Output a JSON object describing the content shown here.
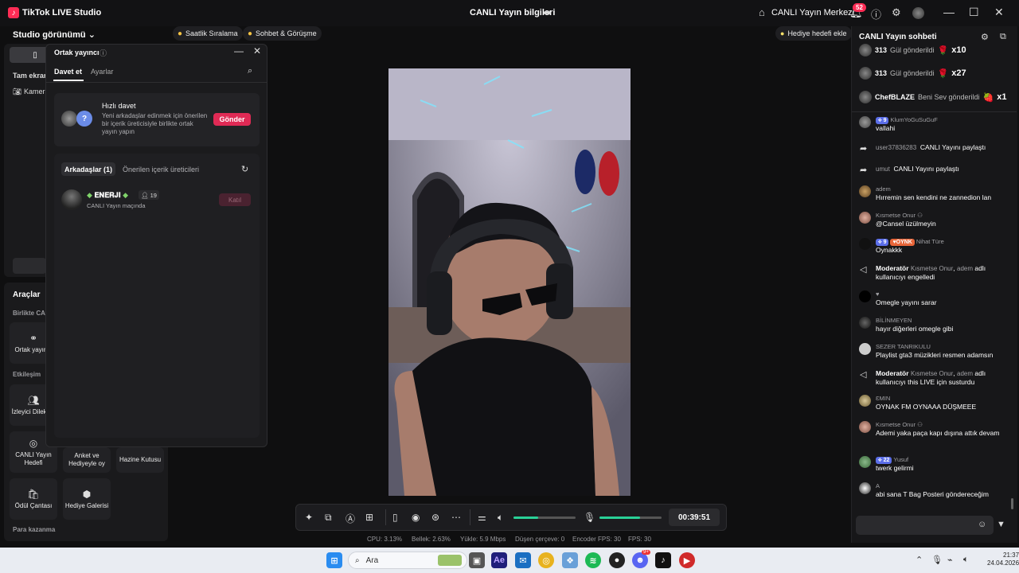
{
  "titlebar": {
    "app_name": "TikTok LIVE Studio",
    "center_title": "CANLI Yayın bilgileri",
    "live_center": "CANLI Yayın Merkezi",
    "notif_count": "52"
  },
  "left": {
    "studio_view": "Studio görünümü",
    "full_screen": "Tam ekran",
    "camera": "Kamera",
    "tools_title": "Araçlar",
    "section_together": "Birlikte CANLI",
    "cohost_tool": "Ortak yayıncı",
    "section_interaction": "Etkileşim",
    "viewer_requests": "İzleyici Dilekleri",
    "live_goal": "CANLI Yayın Hedefi",
    "poll_gift": "Anket ve Hediyeyle oy",
    "treasure": "Hazine Kutusu",
    "reward_bag": "Ödül Çantası",
    "gift_gallery": "Hediye Galerisi",
    "section_earn": "Para kazanma"
  },
  "chips": {
    "hourly_ranking": "Saatlik Sıralama",
    "chat_meet": "Sohbet & Görüşme",
    "add_gift_goal": "Hediye hedefi ekle"
  },
  "cohost_popup": {
    "title": "Ortak yayıncı",
    "tab_invite": "Davet et",
    "tab_settings": "Ayarlar",
    "quick_title": "Hızlı davet",
    "quick_desc": "Yeni arkadaşlar edinmek için önerilen bir içerik üreticisiyle birlikte ortak yayın yapın",
    "send_label": "Gönder",
    "tab_friends": "Arkadaşlar (1)",
    "tab_suggested": "Önerilen içerik üreticileri",
    "friend_name": "𝐄𝐍𝐄𝐑𝐉𝐈",
    "friend_count": "19",
    "friend_status": "CANLI Yayın maçında",
    "join_label": "Katıl"
  },
  "controls": {
    "timer": "00:39:51",
    "volume_level": 0.4,
    "mic_level": 0.65
  },
  "stats": {
    "cpu": "CPU: 3.13%",
    "memory": "Bellek: 2.63%",
    "upload": "Yükle: 5.9 Mbps",
    "dropped": "Düşen çerçeve: 0",
    "encoder_fps": "Encoder FPS: 30",
    "fps": "FPS: 30"
  },
  "chat": {
    "title": "CANLI Yayın sohbeti",
    "gifts": [
      {
        "user": "313",
        "action": "Gül gönderildi",
        "gift": "🌹",
        "mult": "x10"
      },
      {
        "user": "313",
        "action": "Gül gönderildi",
        "gift": "🌹",
        "mult": "x27"
      },
      {
        "user": "ChefBLAZE",
        "action": "Beni Sev gönderildi",
        "gift": "🍓",
        "mult": "x1"
      }
    ],
    "partial_user": "KlumYoGuSuGuF",
    "partial_badge": "9",
    "m1_text": "vallahi",
    "m2_user": "user37836283",
    "m2_text": "CANLI Yayını paylaştı",
    "m3_user": "umut",
    "m3_text": "CANLI Yayını paylaştı",
    "m4_user": "adem",
    "m4_text": "Hırremin sen kendini ne zannedion lan",
    "m5_user": "Kısmetse Onur",
    "m5_text": "@Cansel üzülmeyin",
    "m6_badge1": "9",
    "m6_badge2": "OYNK",
    "m6_user": "Nihat Türe",
    "m6_text": "Oynakkk",
    "m7_label": "Moderatör",
    "m7_user1": "Kısmetse Onur",
    "m7_user2": "adem",
    "m7_text": "adlı kullanıcıyı engelledi",
    "m8_text": "Omegle yayını sarar",
    "m9_user": "BİLİNMEYEN",
    "m9_text": "hayır diğerleri omegle gibi",
    "m10_user": "SEZER TANRIKULU",
    "m10_text": "Playlist gta3 müzikleri resmen adamsın",
    "m11_label": "Moderatör",
    "m11_user1": "Kısmetse Onur",
    "m11_user2": "adem",
    "m11_text": "adlı kullanıcıyı this LIVE için susturdu",
    "m12_user": "ƐMIN",
    "m12_text": "OYNAK FM OYNAAA DÜŞMEEE",
    "m13_user": "Kısmetse Onur",
    "m13_text": "Ademi yaka paça kapı dışına attık devam",
    "m14_badge": "22",
    "m14_user": "Yusuf",
    "m14_text": "twerk gelirmi",
    "m15_user": "A",
    "m15_text": "abi sana T Bag Posteri göndereceğim"
  },
  "taskbar": {
    "search_placeholder": "Ara",
    "time": "21:37",
    "date": "24.04.2026",
    "discord_badge": "9+"
  },
  "colors": {
    "accent": "#fe2c55",
    "send_button": "#e02a55",
    "slider": "#29d197",
    "panel": "#1a1a1c"
  }
}
